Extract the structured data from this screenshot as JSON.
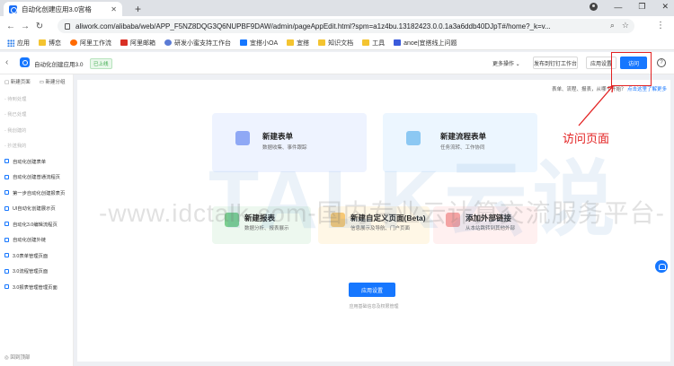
{
  "browser": {
    "tab_title": "自动化创建应用3.0宫格",
    "url": "aliwork.com/alibaba/web/APP_F5NZ8DQG3Q6NUPBF9DAW/admin/pageAppEdit.html?spm=a1z4bu.13182423.0.0.1a3a6ddb40DJpT#/home?_k=v..."
  },
  "bookmarks": [
    "应用",
    "博恋",
    "阿里工作流",
    "阿里邮箱",
    "研发小蜜支持工作台",
    "宜搭小OA",
    "宜搭",
    "知识文档",
    "工具",
    "anoe|宜搭线上问题"
  ],
  "header": {
    "app_name": "自动化创建应用3.0",
    "status": "已上线",
    "more_ops": "更多操作 ⌄",
    "publish_btn": "发布到钉钉工作台",
    "settings_btn": "应用设置",
    "visit_btn": "访问",
    "help": "?"
  },
  "sidebar": {
    "new_page": "新建页面",
    "new_group": "新建分组",
    "items": [
      {
        "label": "- 待到处理",
        "style": "grey"
      },
      {
        "label": "- 我已处理",
        "style": "grey"
      },
      {
        "label": "- 我创建的",
        "style": "grey"
      },
      {
        "label": "- 抄送我的",
        "style": "grey"
      },
      {
        "label": "自动化创建表单",
        "style": "blue"
      },
      {
        "label": "自动化创建普通流程页",
        "style": "blue"
      },
      {
        "label": "第一步自动化创建报表页",
        "style": "blue"
      },
      {
        "label": "UI自动化创建展示页",
        "style": "blue"
      },
      {
        "label": "自动化3.0编辑流程页",
        "style": "blue"
      },
      {
        "label": "自动化创建外链",
        "style": "blue"
      },
      {
        "label": "3.0表单管理页面",
        "style": "blue"
      },
      {
        "label": "3.0流程管理页面",
        "style": "blue"
      },
      {
        "label": "3.0报表管理管理页面",
        "style": "blue"
      }
    ],
    "footer": "◎ 回到顶部"
  },
  "main": {
    "top_hint": "表单、流程、报表，从哪个开始？",
    "top_hint_link": "点击这里了解更多",
    "cards": [
      {
        "title": "新建表单",
        "sub": "数据收集、事件跟踪",
        "color": "#eef3ff",
        "icon_color": "#6c8ff5",
        "icon": "form-icon"
      },
      {
        "title": "新建流程表单",
        "sub": "任务流转、工作协同",
        "color": "#ecf6ff",
        "icon_color": "#5cb0f0",
        "icon": "flow-icon"
      },
      {
        "title": "新建报表",
        "sub": "数据分析、报表展示",
        "color": "#edf8ef",
        "icon_color": "#4fc06a",
        "icon": "report-icon"
      },
      {
        "title": "新建自定义页面(Beta)",
        "sub": "信息展示及导航、门户页面",
        "color": "#fff7e6",
        "icon_color": "#f5b94a",
        "icon": "custom-page-icon"
      },
      {
        "title": "添加外部链接",
        "sub": "从本站跳转到其他外部",
        "color": "#fff0f0",
        "icon_color": "#f07c7c",
        "icon": "link-icon"
      }
    ],
    "setup_btn": "应用设置",
    "setup_hint": "应用基础信息及权限管理"
  },
  "watermark": {
    "logo": "TALK云说",
    "line": "-www.idctalk.com-国内专业云计算交流服务平台-"
  },
  "annotation": {
    "text": "访问页面",
    "color": "#e32222"
  }
}
